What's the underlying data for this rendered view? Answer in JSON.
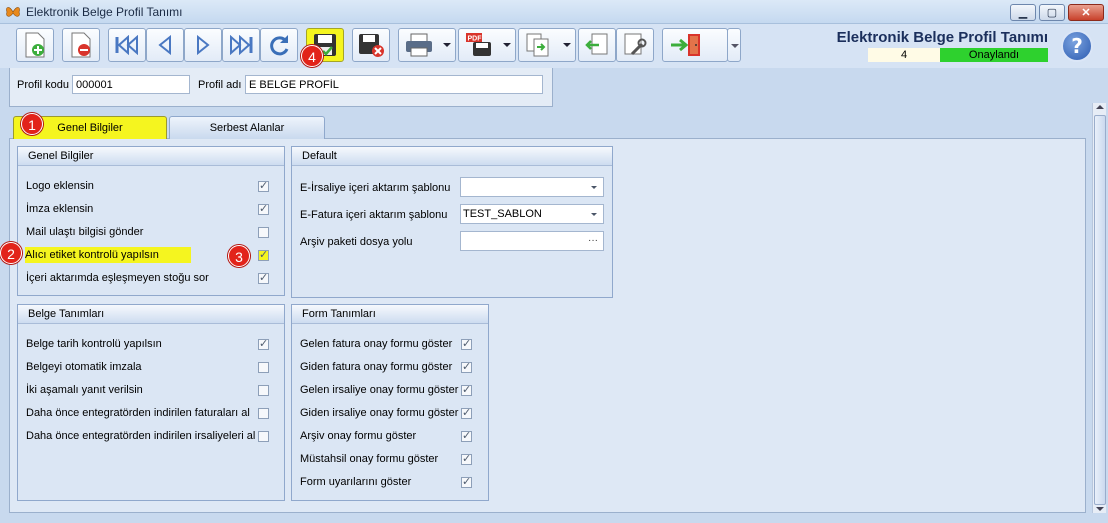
{
  "window": {
    "title": "Elektronik Belge Profil Tanımı",
    "controls": {
      "minimize": "▁",
      "maximize": "▢",
      "close": "✕"
    }
  },
  "toolbar": {
    "buttons": [
      {
        "name": "new-document",
        "icon": "new-document-icon"
      },
      {
        "name": "delete-document",
        "icon": "delete-document-icon"
      },
      {
        "name": "first-record",
        "icon": "first-record-icon"
      },
      {
        "name": "previous-record",
        "icon": "previous-record-icon"
      },
      {
        "name": "next-record",
        "icon": "next-record-icon"
      },
      {
        "name": "last-record",
        "icon": "last-record-icon"
      },
      {
        "name": "refresh",
        "icon": "refresh-icon"
      },
      {
        "name": "save-approve",
        "icon": "save-approve-icon",
        "highlighted": true
      },
      {
        "name": "save-close",
        "icon": "save-close-icon"
      },
      {
        "name": "print",
        "icon": "print-icon"
      },
      {
        "name": "export-pdf",
        "icon": "pdf-icon",
        "pdf_text": "PDF"
      },
      {
        "name": "copy-document",
        "icon": "copy-document-icon"
      },
      {
        "name": "import-document",
        "icon": "import-document-icon"
      },
      {
        "name": "tools",
        "icon": "tools-icon"
      },
      {
        "name": "exit",
        "icon": "exit-door-icon"
      }
    ]
  },
  "header": {
    "title": "Elektronik Belge Profil Tanımı",
    "count": "4",
    "status": "Onaylandı",
    "help": "?"
  },
  "profile": {
    "code_label": "Profil kodu",
    "code_value": "000001",
    "name_label": "Profil adı",
    "name_value": "E BELGE PROFİL"
  },
  "tabs": [
    {
      "label": "Genel Bilgiler",
      "active": true
    },
    {
      "label": "Serbest Alanlar",
      "active": false
    }
  ],
  "groups": {
    "genel": {
      "title": "Genel Bilgiler",
      "items": [
        {
          "label": "Logo eklensin",
          "checked": true
        },
        {
          "label": "İmza eklensin",
          "checked": true
        },
        {
          "label": "Mail ulaştı bilgisi gönder",
          "checked": false
        },
        {
          "label": "Alıcı etiket kontrolü yapılsın",
          "checked": true,
          "highlighted": true
        },
        {
          "label": "İçeri aktarımda eşleşmeyen stoğu sor",
          "checked": true
        }
      ]
    },
    "default": {
      "title": "Default",
      "fields": [
        {
          "label": "E-İrsaliye içeri aktarım şablonu",
          "value": ""
        },
        {
          "label": "E-Fatura içeri aktarım şablonu",
          "value": "TEST_SABLON"
        },
        {
          "label": "Arşiv paketi dosya yolu",
          "value": "",
          "button": "···"
        }
      ]
    },
    "belge": {
      "title": "Belge Tanımları",
      "items": [
        {
          "label": "Belge tarih kontrolü yapılsın",
          "checked": true
        },
        {
          "label": "Belgeyi otomatik imzala",
          "checked": false
        },
        {
          "label": "İki aşamalı yanıt verilsin",
          "checked": false
        },
        {
          "label": "Daha önce entegratörden indirilen faturaları al",
          "checked": false
        },
        {
          "label": "Daha önce entegratörden indirilen irsaliyeleri al",
          "checked": false
        }
      ]
    },
    "form": {
      "title": "Form Tanımları",
      "items": [
        {
          "label": "Gelen fatura onay formu göster",
          "checked": true
        },
        {
          "label": "Giden fatura onay formu göster",
          "checked": true
        },
        {
          "label": "Gelen irsaliye onay formu göster",
          "checked": true
        },
        {
          "label": "Giden irsaliye onay formu göster",
          "checked": true
        },
        {
          "label": "Arşiv onay formu göster",
          "checked": true
        },
        {
          "label": "Müstahsil onay formu göster",
          "checked": true
        },
        {
          "label": "Form uyarılarını göster",
          "checked": true
        }
      ]
    }
  },
  "callouts": [
    "1",
    "2",
    "3",
    "4"
  ],
  "colors": {
    "highlight": "#f5f51f",
    "status_green": "#2ed12e",
    "badge_red": "#e2231a"
  }
}
